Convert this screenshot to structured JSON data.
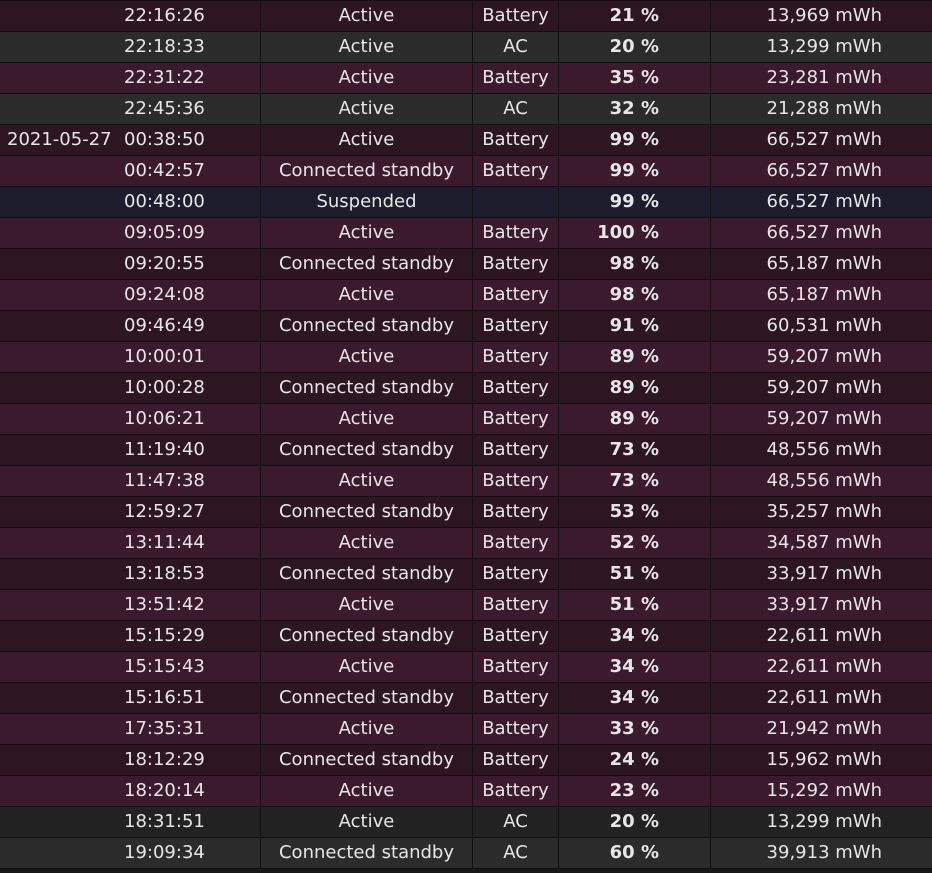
{
  "table": {
    "rows": [
      {
        "date": "",
        "time": "22:16:26",
        "state": "Active",
        "source": "Battery",
        "percent": "21 %",
        "capacity": "13,969 mWh",
        "row_color": "#2d1620"
      },
      {
        "date": "",
        "time": "22:18:33",
        "state": "Active",
        "source": "AC",
        "percent": "20 %",
        "capacity": "13,299 mWh",
        "row_color": "#2b2b2b"
      },
      {
        "date": "",
        "time": "22:31:22",
        "state": "Active",
        "source": "Battery",
        "percent": "35 %",
        "capacity": "23,281 mWh",
        "row_color": "#3c1a2e"
      },
      {
        "date": "",
        "time": "22:45:36",
        "state": "Active",
        "source": "AC",
        "percent": "32 %",
        "capacity": "21,288 mWh",
        "row_color": "#2b2b2b"
      },
      {
        "date": "2021-05-27",
        "time": "00:38:50",
        "state": "Active",
        "source": "Battery",
        "percent": "99 %",
        "capacity": "66,527 mWh",
        "row_color": "#2d1620"
      },
      {
        "date": "",
        "time": "00:42:57",
        "state": "Connected standby",
        "source": "Battery",
        "percent": "99 %",
        "capacity": "66,527 mWh",
        "row_color": "#3c1a2e"
      },
      {
        "date": "",
        "time": "00:48:00",
        "state": "Suspended",
        "source": "",
        "percent": "99 %",
        "capacity": "66,527 mWh",
        "row_color": "#1c1c2d"
      },
      {
        "date": "",
        "time": "09:05:09",
        "state": "Active",
        "source": "Battery",
        "percent": "100 %",
        "capacity": "66,527 mWh",
        "row_color": "#3c1a2e"
      },
      {
        "date": "",
        "time": "09:20:55",
        "state": "Connected standby",
        "source": "Battery",
        "percent": "98 %",
        "capacity": "65,187 mWh",
        "row_color": "#2d1620"
      },
      {
        "date": "",
        "time": "09:24:08",
        "state": "Active",
        "source": "Battery",
        "percent": "98 %",
        "capacity": "65,187 mWh",
        "row_color": "#3c1a2e"
      },
      {
        "date": "",
        "time": "09:46:49",
        "state": "Connected standby",
        "source": "Battery",
        "percent": "91 %",
        "capacity": "60,531 mWh",
        "row_color": "#2d1620"
      },
      {
        "date": "",
        "time": "10:00:01",
        "state": "Active",
        "source": "Battery",
        "percent": "89 %",
        "capacity": "59,207 mWh",
        "row_color": "#3c1a2e"
      },
      {
        "date": "",
        "time": "10:00:28",
        "state": "Connected standby",
        "source": "Battery",
        "percent": "89 %",
        "capacity": "59,207 mWh",
        "row_color": "#2d1620"
      },
      {
        "date": "",
        "time": "10:06:21",
        "state": "Active",
        "source": "Battery",
        "percent": "89 %",
        "capacity": "59,207 mWh",
        "row_color": "#3c1a2e"
      },
      {
        "date": "",
        "time": "11:19:40",
        "state": "Connected standby",
        "source": "Battery",
        "percent": "73 %",
        "capacity": "48,556 mWh",
        "row_color": "#2d1620"
      },
      {
        "date": "",
        "time": "11:47:38",
        "state": "Active",
        "source": "Battery",
        "percent": "73 %",
        "capacity": "48,556 mWh",
        "row_color": "#3c1a2e"
      },
      {
        "date": "",
        "time": "12:59:27",
        "state": "Connected standby",
        "source": "Battery",
        "percent": "53 %",
        "capacity": "35,257 mWh",
        "row_color": "#2d1620"
      },
      {
        "date": "",
        "time": "13:11:44",
        "state": "Active",
        "source": "Battery",
        "percent": "52 %",
        "capacity": "34,587 mWh",
        "row_color": "#3c1a2e"
      },
      {
        "date": "",
        "time": "13:18:53",
        "state": "Connected standby",
        "source": "Battery",
        "percent": "51 %",
        "capacity": "33,917 mWh",
        "row_color": "#2d1620"
      },
      {
        "date": "",
        "time": "13:51:42",
        "state": "Active",
        "source": "Battery",
        "percent": "51 %",
        "capacity": "33,917 mWh",
        "row_color": "#3c1a2e"
      },
      {
        "date": "",
        "time": "15:15:29",
        "state": "Connected standby",
        "source": "Battery",
        "percent": "34 %",
        "capacity": "22,611 mWh",
        "row_color": "#2d1620"
      },
      {
        "date": "",
        "time": "15:15:43",
        "state": "Active",
        "source": "Battery",
        "percent": "34 %",
        "capacity": "22,611 mWh",
        "row_color": "#3c1a2e"
      },
      {
        "date": "",
        "time": "15:16:51",
        "state": "Connected standby",
        "source": "Battery",
        "percent": "34 %",
        "capacity": "22,611 mWh",
        "row_color": "#2d1620"
      },
      {
        "date": "",
        "time": "17:35:31",
        "state": "Active",
        "source": "Battery",
        "percent": "33 %",
        "capacity": "21,942 mWh",
        "row_color": "#3c1a2e"
      },
      {
        "date": "",
        "time": "18:12:29",
        "state": "Connected standby",
        "source": "Battery",
        "percent": "24 %",
        "capacity": "15,962 mWh",
        "row_color": "#2d1620"
      },
      {
        "date": "",
        "time": "18:20:14",
        "state": "Active",
        "source": "Battery",
        "percent": "23 %",
        "capacity": "15,292 mWh",
        "row_color": "#3c1a2e"
      },
      {
        "date": "",
        "time": "18:31:51",
        "state": "Active",
        "source": "AC",
        "percent": "20 %",
        "capacity": "13,299 mWh",
        "row_color": "#222222"
      },
      {
        "date": "",
        "time": "19:09:34",
        "state": "Connected standby",
        "source": "AC",
        "percent": "60 %",
        "capacity": "39,913 mWh",
        "row_color": "#2b2b2b"
      }
    ]
  }
}
